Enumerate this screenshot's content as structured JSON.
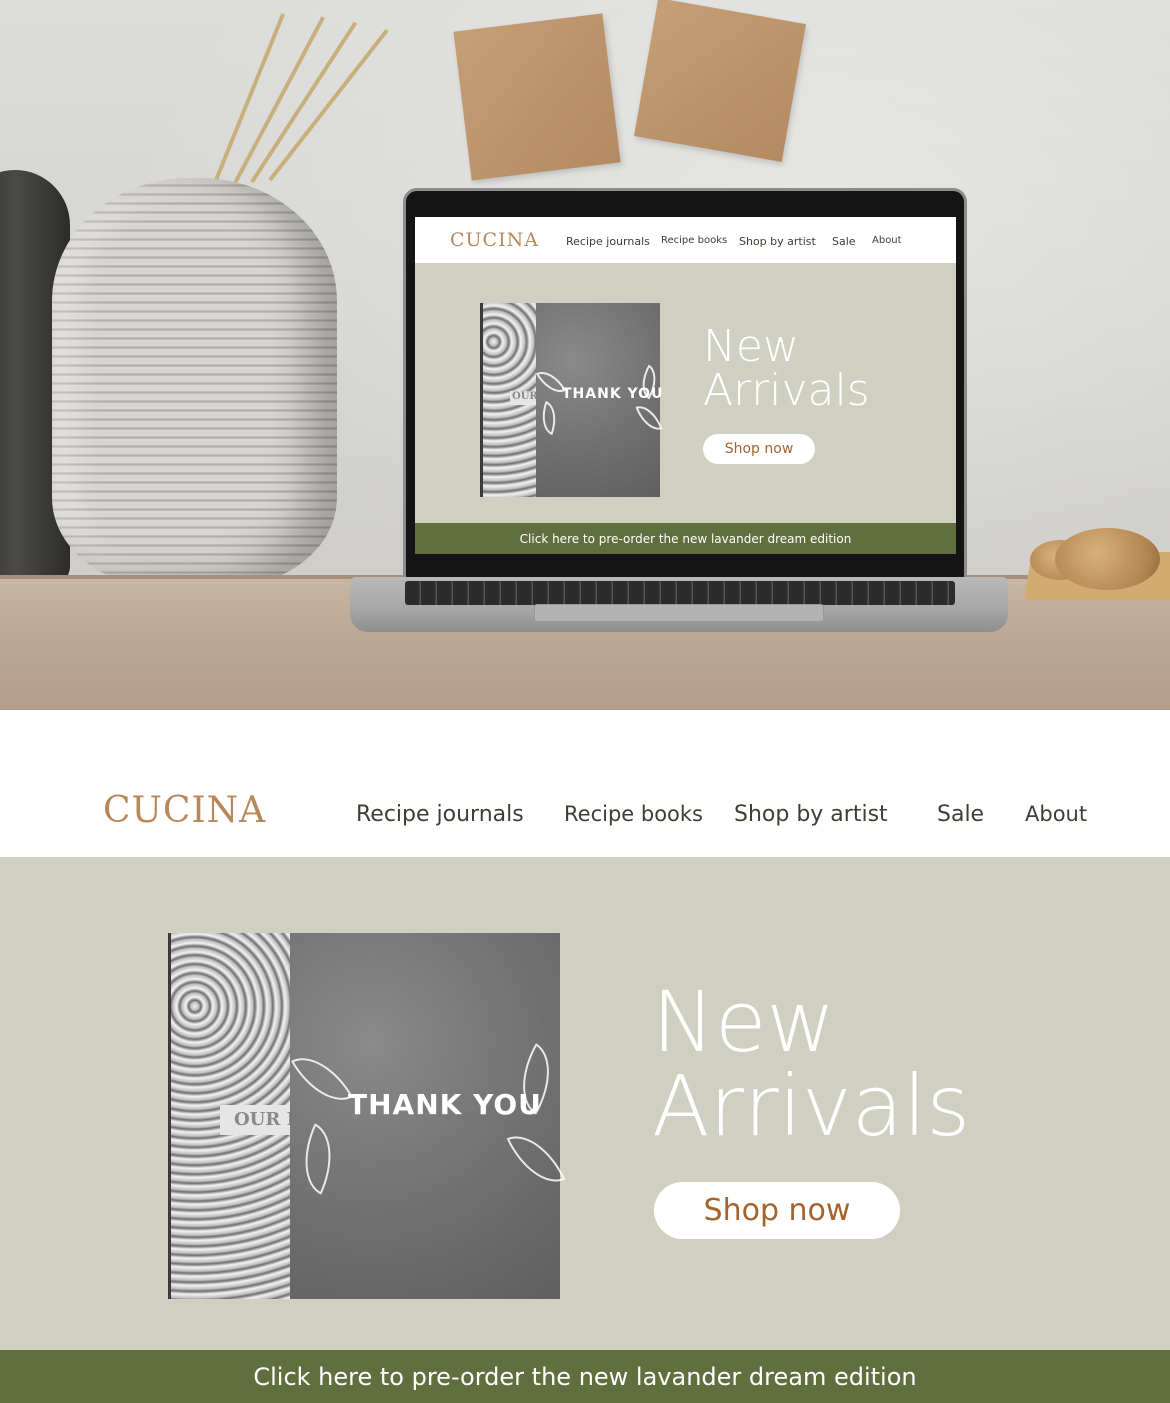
{
  "site": {
    "logo": "CUCINA",
    "nav": [
      "Recipe journals",
      "Recipe books",
      "Shop by artist",
      "Sale",
      "About"
    ],
    "hero": {
      "headline_line1": "New",
      "headline_line2": "Arrivals",
      "cta_label": "Shop now"
    },
    "product": {
      "cover_text": "THANK YOU",
      "spine_label": "OUR R"
    },
    "banner_text": "Click here to pre-order the new lavander dream edition"
  },
  "colors": {
    "brand_logo": "#b8885d",
    "hero_background": "#cfd0c2",
    "banner_background": "#616e3d",
    "cta_text": "#a5632d"
  }
}
